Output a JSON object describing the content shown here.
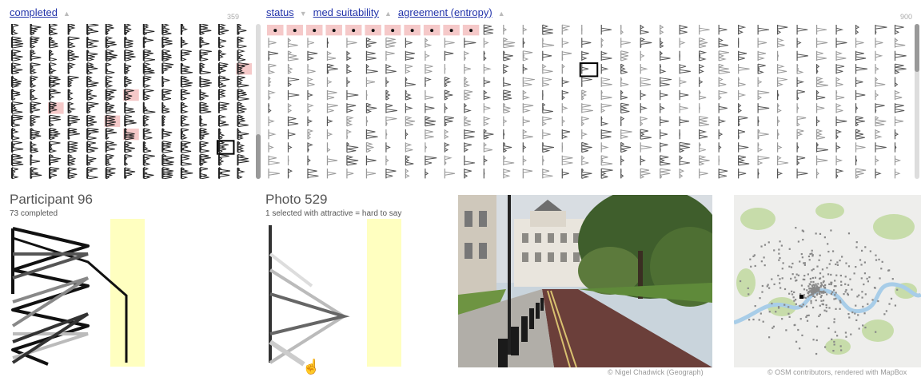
{
  "left_panel": {
    "sort_label": "completed",
    "count": "359",
    "sort_caret": "up-triangle"
  },
  "right_panel": {
    "sort_labels": [
      "status",
      "med suitability",
      "agreement (entropy)"
    ],
    "sort_carets": [
      "down-triangle",
      "up-triangle",
      "up-triangle"
    ],
    "count": "900"
  },
  "participant": {
    "title": "Participant 96",
    "subtitle": "73 completed"
  },
  "photo": {
    "title": "Photo 529",
    "subtitle": "1 selected with attractive = hard to say"
  },
  "credits": {
    "photo": "© Nigel Chadwick (Geograph)",
    "map": "© OSM contributors, rendered with MapBox"
  },
  "colors": {
    "link": "#2233aa",
    "highlight_pink": "#f5c9c9",
    "highlight_yellow": "#ffffc0",
    "glyph_dark": "#222222"
  },
  "icons": [
    "up-triangle",
    "down-triangle",
    "hand-cursor-icon"
  ]
}
